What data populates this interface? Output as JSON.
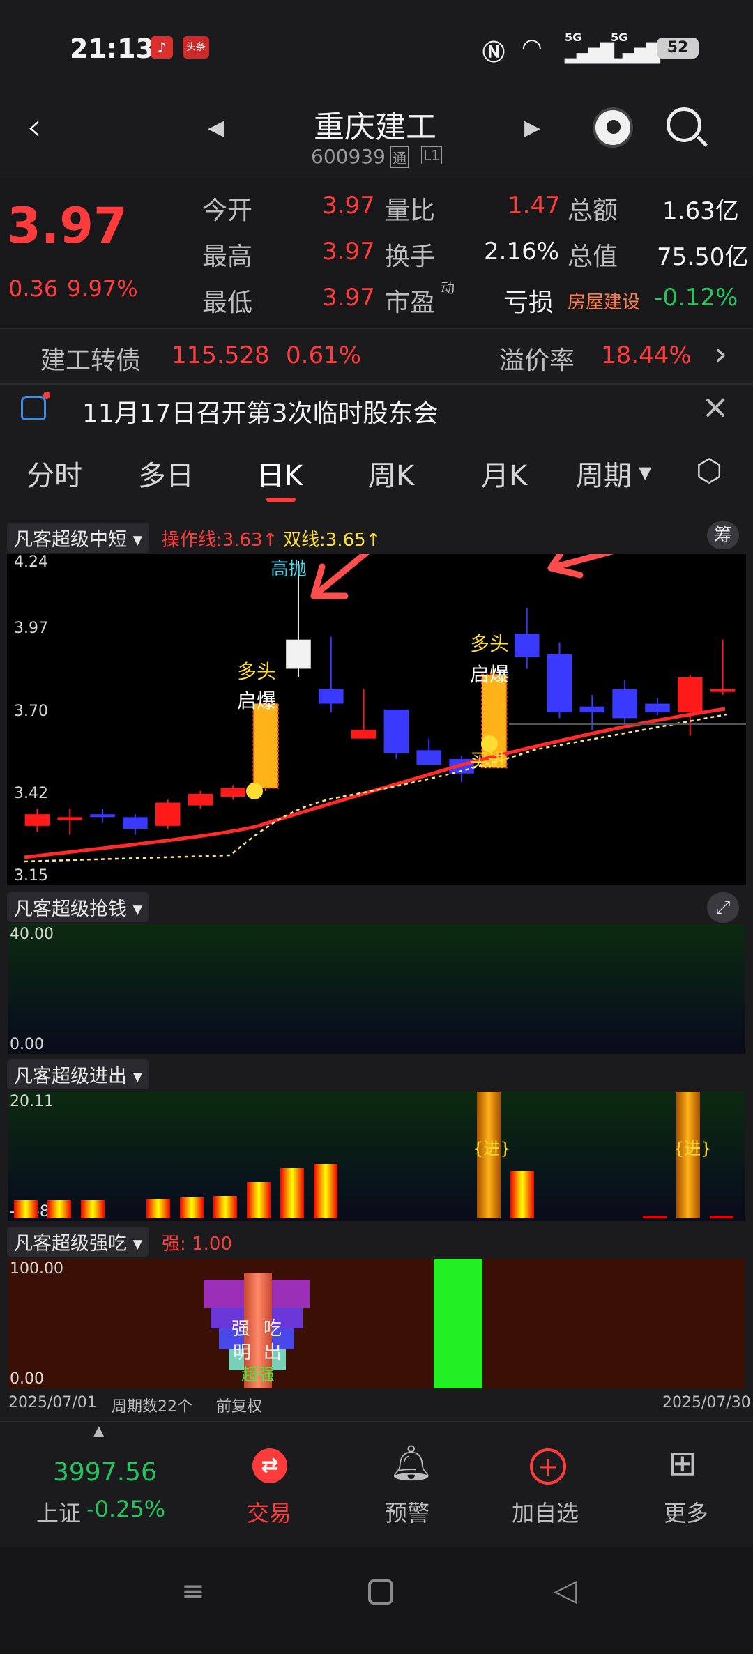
{
  "status": {
    "time": "21:13",
    "network1": "5G",
    "network2": "5G",
    "battery": "52"
  },
  "header": {
    "title": "重庆建工",
    "code": "600939",
    "badge1": "通",
    "badge2": "L1"
  },
  "quote": {
    "price": "3.97",
    "change": "0.36",
    "change_pct": "9.97%",
    "open_label": "今开",
    "open": "3.97",
    "high_label": "最高",
    "high": "3.97",
    "low_label": "最低",
    "low": "3.97",
    "vol_ratio_label": "量比",
    "vol_ratio": "1.47",
    "turnover_label": "换手",
    "turnover": "2.16%",
    "pe_label": "市盈",
    "pe_sup": "动",
    "pe": "亏损",
    "amount_label": "总额",
    "amount": "1.63亿",
    "mktcap_label": "总值",
    "mktcap": "75.50亿",
    "sector": "房屋建设",
    "sector_pct": "-0.12%"
  },
  "bond": {
    "name": "建工转债",
    "price": "115.528",
    "pct": "0.61%",
    "premium_label": "溢价率",
    "premium": "18.44%"
  },
  "notice": {
    "text": "11月17日召开第3次临时股东会"
  },
  "tabs": [
    "分时",
    "多日",
    "日K",
    "周K",
    "月K",
    "周期"
  ],
  "active_tab": "日K",
  "main_chart": {
    "indicator": "凡客超级中短",
    "op_line": "操作线:3.63↑",
    "dual_line": "双线:3.65↑",
    "chip": "筹",
    "y_labels": [
      "4.24",
      "3.97",
      "3.70",
      "3.42",
      "3.15"
    ],
    "tag_high": "高抛",
    "tag_bull1": "多头",
    "tag_burst1": "启爆",
    "tag_bull2": "多头",
    "tag_burst2": "启爆",
    "tag_buy": "买进"
  },
  "chart_data": {
    "type": "candlestick",
    "ylim": [
      3.15,
      4.24
    ],
    "candles": [
      {
        "o": 3.37,
        "c": 3.33,
        "h": 3.39,
        "l": 3.31,
        "color": "red"
      },
      {
        "o": 3.36,
        "c": 3.35,
        "h": 3.39,
        "l": 3.3,
        "color": "red"
      },
      {
        "o": 3.37,
        "c": 3.36,
        "h": 3.39,
        "l": 3.34,
        "color": "blue"
      },
      {
        "o": 3.36,
        "c": 3.32,
        "h": 3.37,
        "l": 3.3,
        "color": "blue"
      },
      {
        "o": 3.33,
        "c": 3.41,
        "h": 3.42,
        "l": 3.32,
        "color": "red"
      },
      {
        "o": 3.4,
        "c": 3.44,
        "h": 3.45,
        "l": 3.39,
        "color": "red"
      },
      {
        "o": 3.43,
        "c": 3.46,
        "h": 3.47,
        "l": 3.42,
        "color": "red"
      },
      {
        "o": 3.46,
        "c": 3.75,
        "h": 3.75,
        "l": 3.45,
        "color": "orange"
      },
      {
        "o": 3.97,
        "c": 3.87,
        "h": 4.24,
        "l": 3.84,
        "color": "white"
      },
      {
        "o": 3.8,
        "c": 3.75,
        "h": 3.98,
        "l": 3.72,
        "color": "blue"
      },
      {
        "o": 3.66,
        "c": 3.63,
        "h": 3.8,
        "l": 3.63,
        "color": "red"
      },
      {
        "o": 3.73,
        "c": 3.58,
        "h": 3.73,
        "l": 3.56,
        "color": "blue"
      },
      {
        "o": 3.59,
        "c": 3.54,
        "h": 3.63,
        "l": 3.54,
        "color": "blue"
      },
      {
        "o": 3.56,
        "c": 3.51,
        "h": 3.57,
        "l": 3.48,
        "color": "blue"
      },
      {
        "o": 3.53,
        "c": 3.85,
        "h": 3.87,
        "l": 3.53,
        "color": "orange"
      },
      {
        "o": 3.99,
        "c": 3.91,
        "h": 4.08,
        "l": 3.87,
        "color": "blue"
      },
      {
        "o": 3.92,
        "c": 3.72,
        "h": 3.96,
        "l": 3.7,
        "color": "blue"
      },
      {
        "o": 3.74,
        "c": 3.72,
        "h": 3.78,
        "l": 3.66,
        "color": "blue"
      },
      {
        "o": 3.8,
        "c": 3.7,
        "h": 3.83,
        "l": 3.68,
        "color": "blue"
      },
      {
        "o": 3.75,
        "c": 3.72,
        "h": 3.77,
        "l": 3.71,
        "color": "blue"
      },
      {
        "o": 3.72,
        "c": 3.84,
        "h": 3.85,
        "l": 3.64,
        "color": "red"
      },
      {
        "o": 3.8,
        "c": 3.8,
        "h": 3.97,
        "l": 3.78,
        "color": "red"
      }
    ]
  },
  "panel2": {
    "indicator": "凡客超级抢钱",
    "top": "40.00",
    "bottom": "0.00"
  },
  "panel3": {
    "indicator": "凡客超级进出",
    "top": "20.11",
    "bottom": "-0.68",
    "tag1": "{进}",
    "tag2": "{进}"
  },
  "panel4": {
    "indicator": "凡客超级强吃",
    "strong": "强: 1.00",
    "top": "100.00",
    "bottom": "0.00",
    "t1": "强",
    "t2": "吃",
    "t3": "明",
    "t4": "出",
    "t5": "超强"
  },
  "xaxis": {
    "start": "2025/07/01",
    "count": "周期数22个",
    "adjust": "前复权",
    "end": "2025/07/30"
  },
  "bottom": {
    "index_value": "3997.56",
    "index_name": "上证",
    "index_pct": "-0.25%",
    "trade": "交易",
    "alert": "预警",
    "watch": "加自选",
    "more": "更多"
  }
}
